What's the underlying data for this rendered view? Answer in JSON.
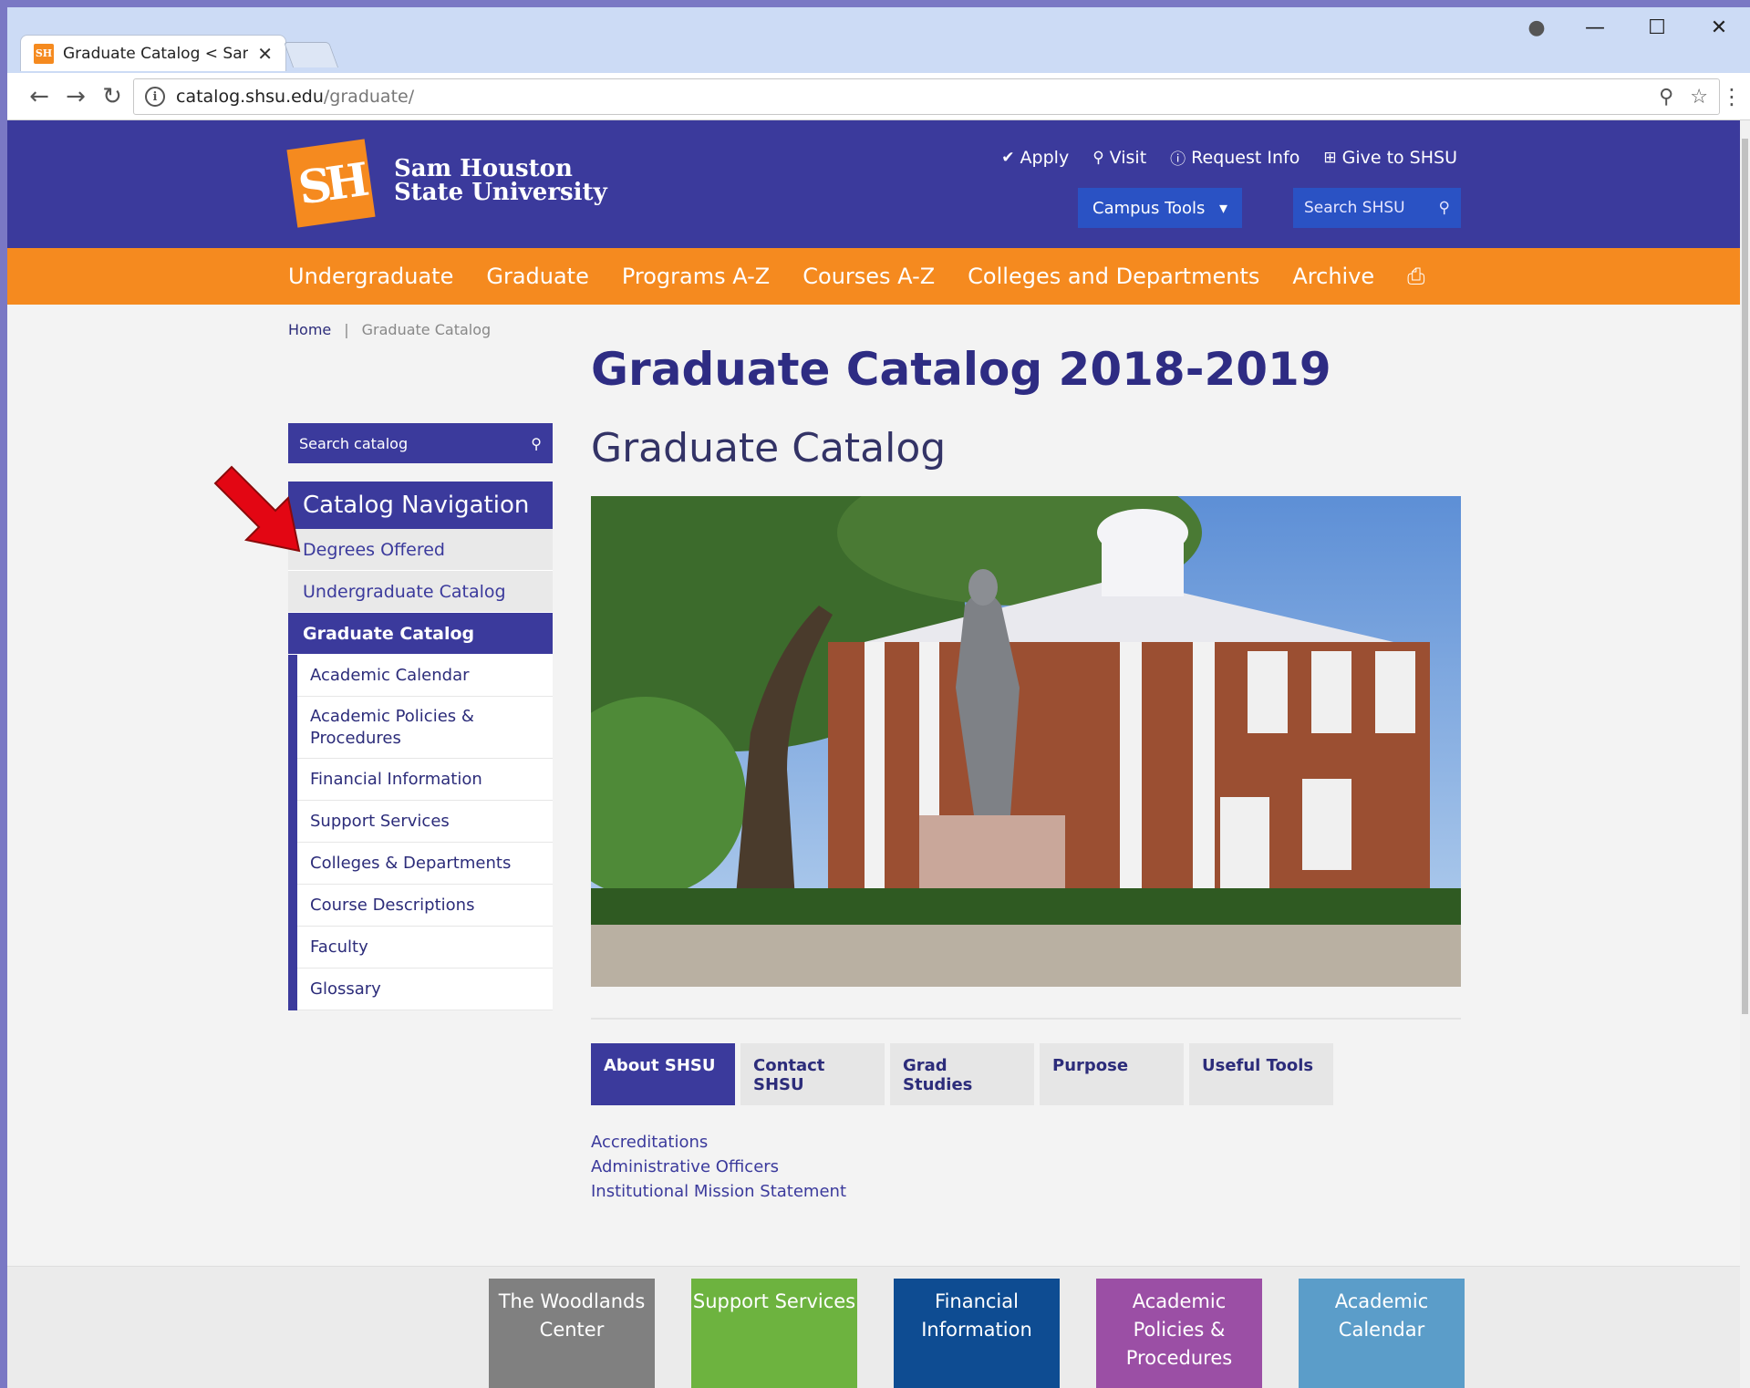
{
  "browser": {
    "tab_title": "Graduate Catalog < Sam",
    "favicon_text": "SH",
    "url_host": "catalog.shsu.edu",
    "url_path": "/graduate/"
  },
  "header": {
    "logo_mark": "SH",
    "logo_line1": "Sam Houston",
    "logo_line2": "State University",
    "util_links": [
      "Apply",
      "Visit",
      "Request Info",
      "Give to SHSU"
    ],
    "campus_tools": "Campus Tools",
    "search_placeholder": "Search SHSU"
  },
  "main_nav": [
    "Undergraduate",
    "Graduate",
    "Programs A-Z",
    "Courses A-Z",
    "Colleges and Departments",
    "Archive"
  ],
  "breadcrumb": {
    "home": "Home",
    "separator": "|",
    "current": "Graduate Catalog"
  },
  "page_title": "Graduate Catalog 2018-2019",
  "sidebar": {
    "search_placeholder": "Search catalog",
    "nav_title": "Catalog Navigation",
    "items": [
      "Degrees Offered",
      "Undergraduate Catalog"
    ],
    "active_item": "Graduate Catalog",
    "sub_items": [
      "Academic Calendar",
      "Academic Policies & Procedures",
      "Financial Information",
      "Support Services",
      "Colleges & Departments",
      "Course Descriptions",
      "Faculty",
      "Glossary"
    ]
  },
  "content": {
    "title": "Graduate Catalog",
    "tabs": [
      "About SHSU",
      "Contact SHSU",
      "Grad Studies",
      "Purpose",
      "Useful Tools"
    ],
    "active_tab": "About SHSU",
    "links": [
      "Accreditations",
      "Administrative Officers",
      "Institutional Mission Statement"
    ]
  },
  "footer_tiles": [
    {
      "label": "The Woodlands Center",
      "color": "#808080"
    },
    {
      "label": "Support Services",
      "color": "#6db33f"
    },
    {
      "label": "Financial Information",
      "color": "#0e4c92"
    },
    {
      "label": "Academic Policies & Procedures",
      "color": "#9b4fa5"
    },
    {
      "label": "Academic Calendar",
      "color": "#5b9dc9"
    }
  ],
  "colors": {
    "brand_blue": "#3b3a9c",
    "brand_orange": "#f58a1f",
    "annotation_arrow": "#e30613"
  }
}
